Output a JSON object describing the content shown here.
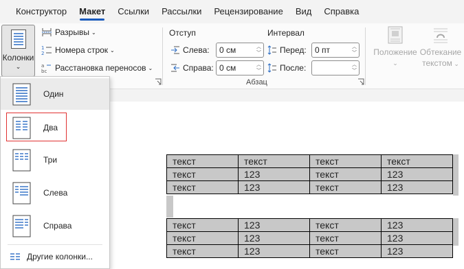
{
  "tabs": [
    {
      "label": "Конструктор",
      "active": false
    },
    {
      "label": "Макет",
      "active": true
    },
    {
      "label": "Ссылки",
      "active": false
    },
    {
      "label": "Рассылки",
      "active": false
    },
    {
      "label": "Рецензирование",
      "active": false
    },
    {
      "label": "Вид",
      "active": false
    },
    {
      "label": "Справка",
      "active": false
    }
  ],
  "page_setup": {
    "columns_label": "Колонки",
    "breaks_label": "Разрывы",
    "line_numbers_label": "Номера строк",
    "hyphenation_label": "Расстановка переносов"
  },
  "paragraph": {
    "indent_title": "Отступ",
    "spacing_title": "Интервал",
    "left_label": "Слева:",
    "left_value": "0 см",
    "right_label": "Справа:",
    "right_value": "0 см",
    "before_label": "Перед:",
    "before_value": "0 пт",
    "after_label": "После:",
    "after_value": "",
    "group_label": "Абзац"
  },
  "arrange": {
    "position_label_1": "Положение",
    "wrap_label_1": "Обтекание",
    "wrap_label_2": "текстом"
  },
  "columns_menu": {
    "items": [
      {
        "label": "Один"
      },
      {
        "label": "Два"
      },
      {
        "label": "Три"
      },
      {
        "label": "Слева"
      },
      {
        "label": "Справа"
      }
    ],
    "more_label": "Другие колонки..."
  },
  "colors": {
    "accent": "#185abd",
    "highlight_border": "#e03030",
    "cell_fill": "#c8c8c8"
  },
  "document": {
    "table1": [
      [
        "текст",
        "текст",
        "текст",
        "текст"
      ],
      [
        "текст",
        "123",
        "текст",
        "123"
      ],
      [
        "текст",
        "123",
        "текст",
        "123"
      ]
    ],
    "table2": [
      [
        "текст",
        "123",
        "текст",
        "123"
      ],
      [
        "текст",
        "123",
        "текст",
        "123"
      ],
      [
        "текст",
        "123",
        "текст",
        "123"
      ]
    ]
  }
}
